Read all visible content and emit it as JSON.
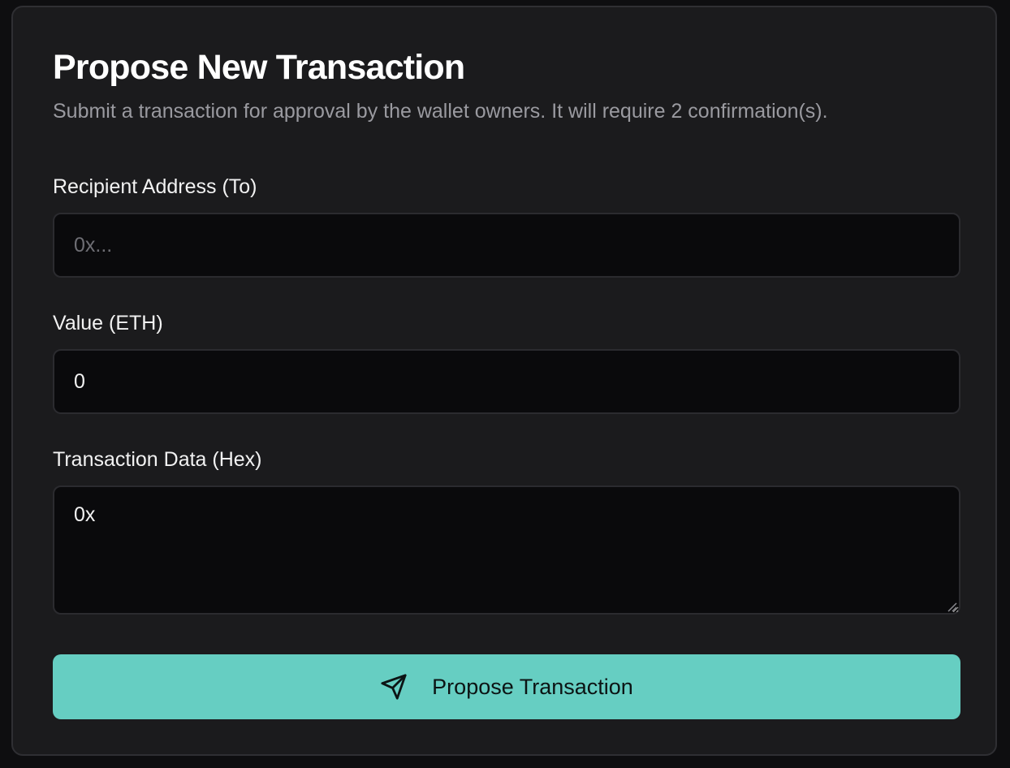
{
  "form": {
    "title": "Propose New Transaction",
    "subtitle": "Submit a transaction for approval by the wallet owners. It will require 2 confirmation(s).",
    "recipient": {
      "label": "Recipient Address (To)",
      "placeholder": "0x...",
      "value": ""
    },
    "value_eth": {
      "label": "Value (ETH)",
      "value": "0"
    },
    "tx_data": {
      "label": "Transaction Data (Hex)",
      "value": "0x"
    },
    "submit": {
      "label": "Propose Transaction",
      "icon": "send-icon"
    }
  },
  "colors": {
    "page_bg": "#0e0e10",
    "card_bg": "#1b1b1d",
    "input_bg": "#0a0a0c",
    "accent": "#66cec2",
    "muted_text": "#9a9aa0"
  }
}
